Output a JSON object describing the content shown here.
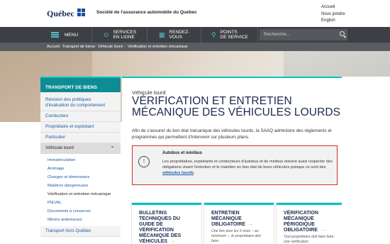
{
  "header": {
    "logo": "Québec",
    "org": "Société de l'assurance automobile du Québec",
    "links": [
      "Accueil",
      "Nous joindre",
      "English"
    ]
  },
  "nav": {
    "menu": "MENU",
    "services": [
      "SERVICES",
      "EN LIGNE"
    ],
    "rdv": [
      "RENDEZ-",
      "VOUS"
    ],
    "points": [
      "POINTS",
      "DE SERVICE"
    ],
    "search_placeholder": "Recherche..."
  },
  "breadcrumb": [
    "Accueil",
    "Transport de biens",
    "Véhicule lourd",
    "Vérification et entretien mécanique"
  ],
  "sidebar": {
    "heading": "TRANSPORT DE BIENS",
    "items": [
      "Révision des politiques d'évaluation du comportement",
      "Conducteur",
      "Propriétaire et exploitant",
      "Particulier",
      "Véhicule lourd"
    ],
    "sub_items": [
      "Immatriculation",
      "Arrimage",
      "Charges et dimensions",
      "Matières dangereuses",
      "Vérification et entretien mécanique",
      "PIEVAL",
      "Documents à conserver",
      "Miroirs antéviseurs"
    ],
    "after": "Transport hors Québec"
  },
  "main": {
    "kicker": "Véhicule lourd",
    "title": "VÉRIFICATION ET ENTRETIEN MÉCANIQUE DES VÉHICULES LOURDS",
    "intro": "Afin de s'assurer du bon état mécanique des véhicules lourds, la SAAQ administre des règlements et programmes qui permettent d'intervenir sur plusieurs plans.",
    "alert": {
      "title": "Autobus et minibus",
      "text": "Les propriétaires, exploitants et conducteurs d'autobus et de minibus doivent aussi respecter des obligations visant l'entretien et le maintien en bon état de leurs véhicules puisque ce sont des",
      "link": "véhicules lourds",
      "end": "."
    },
    "cards": [
      {
        "title": "BULLETINS TECHNIQUES DU GUIDE DE VÉRIFICATION MÉCANIQUE DES VÉHICULES",
        "desc": ""
      },
      {
        "title": "ENTRETIEN MÉCANIQUE OBLIGATOIRE",
        "desc": "Une fois tous les 6 mois – au minimum –, le propriétaire doit faire"
      },
      {
        "title": "VÉRIFICATION MÉCANIQUE PÉRIODIQUE OBLIGATOIRE",
        "desc": "Tout propriétaire doit faire faire une vérification"
      }
    ]
  },
  "colors": {
    "accent": "#00c6c6",
    "nav_bg": "#3c3f43",
    "title": "#1b2a4e",
    "alert_border": "#c6322a",
    "link": "#1a5ca8"
  }
}
